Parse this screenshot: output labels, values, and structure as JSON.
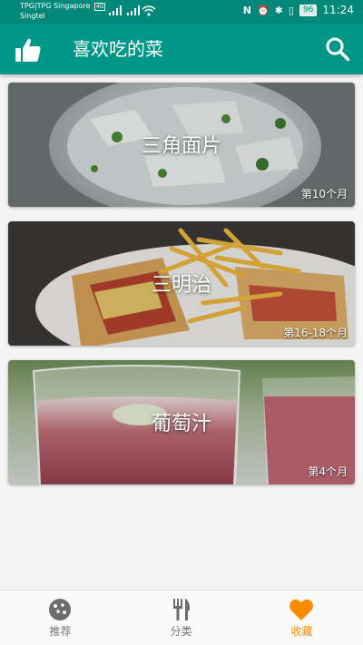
{
  "status_bar": {
    "carrier_line1": "TPG|TPG Singapore",
    "carrier_line2": "Singtel",
    "net_badge": "4G",
    "battery": "96",
    "time": "11:24"
  },
  "app_bar": {
    "title": "喜欢吃的菜",
    "left_icon": "thumbs-up-icon",
    "right_icon": "search-icon"
  },
  "dishes": [
    {
      "name": "三角面片",
      "age": "第10个月"
    },
    {
      "name": "三明治",
      "age": "第16-18个月"
    },
    {
      "name": "葡萄汁",
      "age": "第4个月"
    }
  ],
  "bottom_nav": {
    "items": [
      {
        "label": "推荐",
        "icon": "cookie-icon",
        "active": false
      },
      {
        "label": "分类",
        "icon": "cutlery-icon",
        "active": false
      },
      {
        "label": "收藏",
        "icon": "heart-icon",
        "active": true
      }
    ]
  },
  "colors": {
    "primary": "#009688",
    "status_bar": "#00897b",
    "active_tab": "#fb8c00",
    "inactive_tab": "#757575"
  }
}
